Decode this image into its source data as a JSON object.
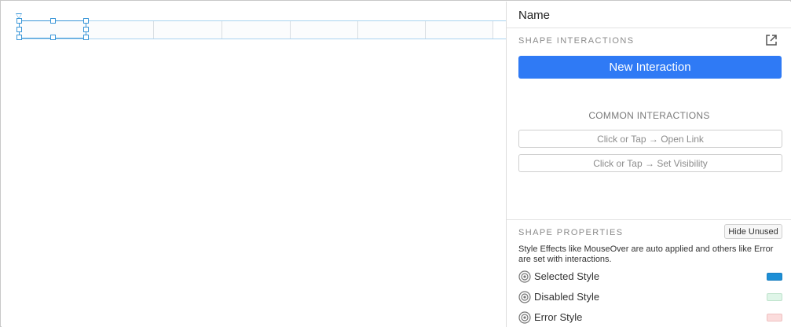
{
  "panel": {
    "name_label": "Name",
    "shape_interactions_title": "SHAPE INTERACTIONS",
    "popout_icon": "external-link-icon",
    "new_interaction_label": "New Interaction",
    "common_interactions_title": "COMMON INTERACTIONS",
    "common_interactions": [
      {
        "label": "Click or Tap → Open Link"
      },
      {
        "label": "Click or Tap → Set Visibility"
      }
    ],
    "shape_properties_title": "SHAPE PROPERTIES",
    "hide_unused_label": "Hide Unused",
    "help_text": "Style Effects like MouseOver are auto applied and others like Error are set with interactions.",
    "styles": [
      {
        "label": "Selected Style",
        "color": "#1d8fd6"
      },
      {
        "label": "Disabled Style",
        "color": "#dff5e8"
      },
      {
        "label": "Error Style",
        "color": "#fbdcdc"
      }
    ]
  },
  "colors": {
    "accent": "#2f7af5",
    "selection": "#3a96d8"
  }
}
